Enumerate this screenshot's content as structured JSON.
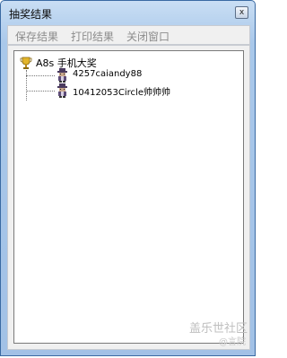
{
  "window": {
    "title": "抽奖结果",
    "close_label": "x"
  },
  "menu": {
    "items": [
      "保存结果",
      "打印结果",
      "关闭窗口"
    ]
  },
  "tree": {
    "root": {
      "label": "A8s 手机大奖",
      "icon": "trophy-icon"
    },
    "children": [
      {
        "label": "4257caiandy88",
        "icon": "person-icon"
      },
      {
        "label": "10412053Circle帅帅帅",
        "icon": "person-icon"
      }
    ]
  },
  "watermark": {
    "line1": "盖乐世社区",
    "line2": "@言院"
  },
  "colors": {
    "titlebar": "#a9c8ea",
    "disabled_text": "#8c8c8c",
    "frame": "#3a6aa3"
  }
}
